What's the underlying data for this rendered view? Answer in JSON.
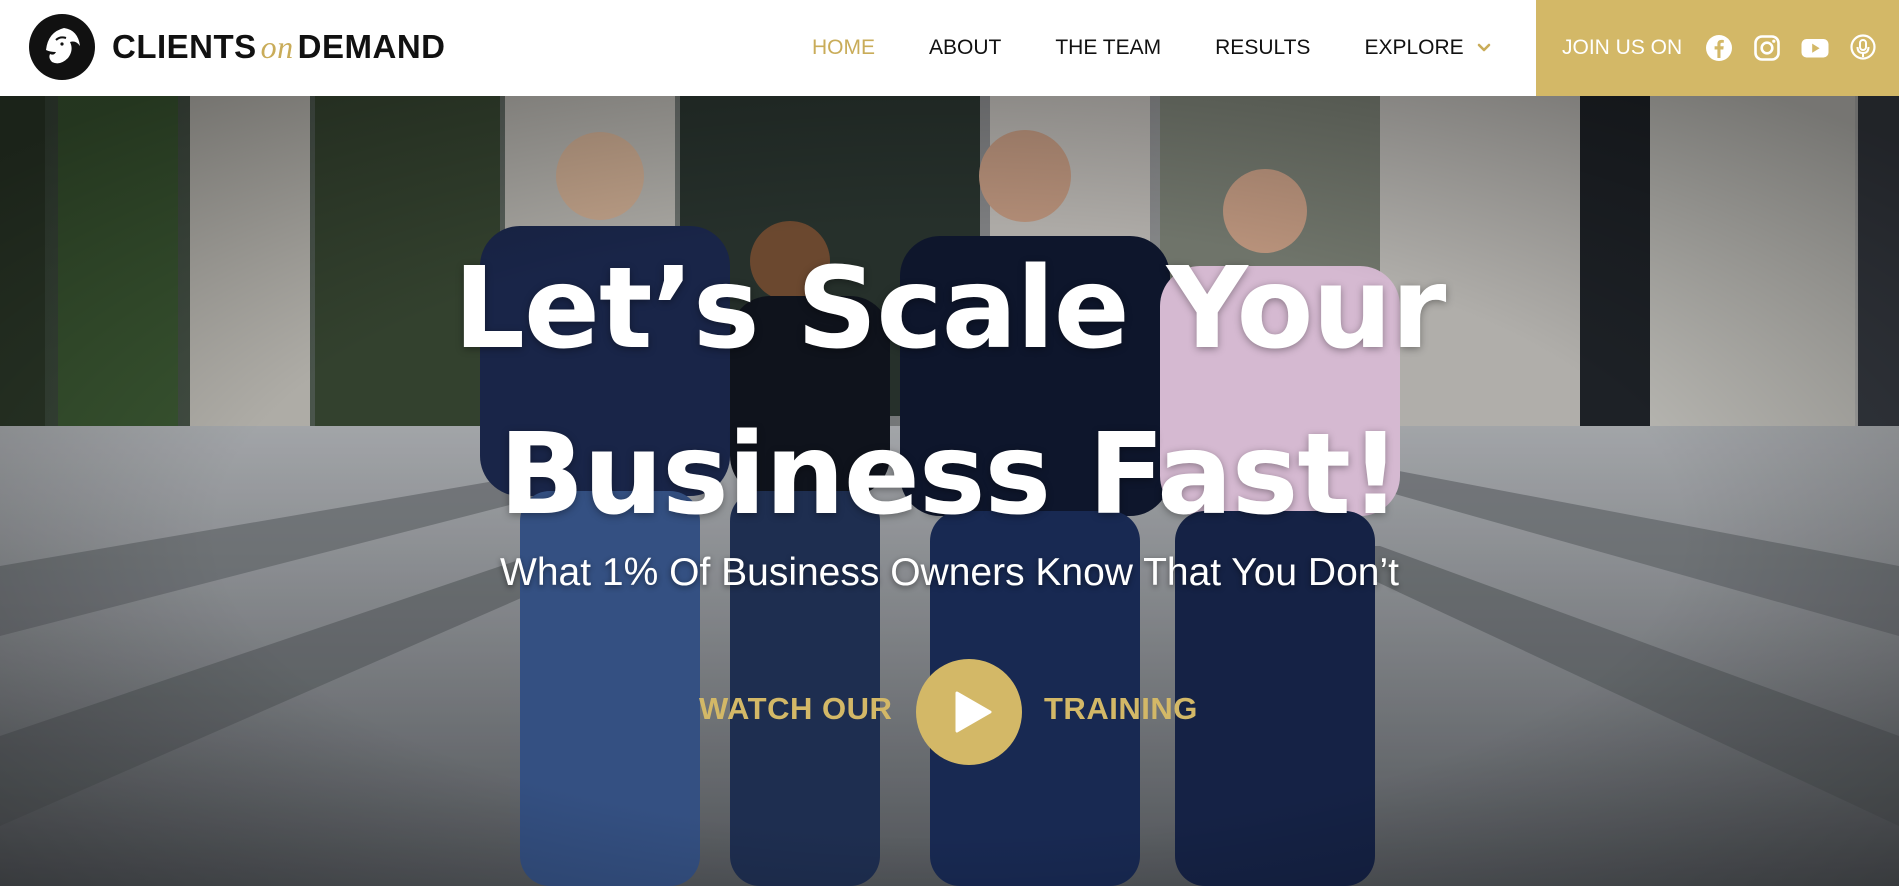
{
  "brand": {
    "name_part1": "CLIENTS",
    "name_part2": "on",
    "name_part3": "DEMAND",
    "accent_color": "#c9ac59",
    "join_bar_color": "#d3b867"
  },
  "nav": {
    "items": [
      {
        "label": "HOME",
        "active": true
      },
      {
        "label": "ABOUT",
        "active": false
      },
      {
        "label": "THE TEAM",
        "active": false
      },
      {
        "label": "RESULTS",
        "active": false
      },
      {
        "label": "EXPLORE",
        "active": false,
        "has_dropdown": true
      }
    ]
  },
  "join": {
    "label": "JOIN US ON",
    "icons": [
      "facebook-icon",
      "instagram-icon",
      "youtube-icon",
      "podcast-icon"
    ]
  },
  "hero": {
    "title_line1": "Let’s Scale Your",
    "title_line2": "Business Fast!",
    "subtitle": "What 1% Of Business Owners Know That You Don’t",
    "cta_left": "WATCH OUR",
    "cta_right": "TRAINING"
  }
}
